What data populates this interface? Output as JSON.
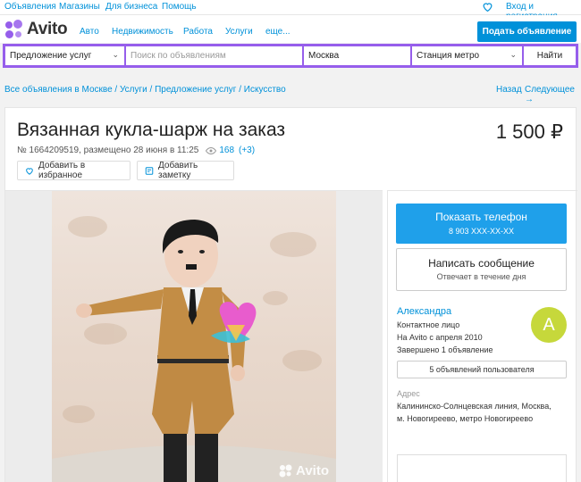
{
  "topbar": {
    "links": [
      "Объявления",
      "Магазины",
      "Для бизнеса",
      "Помощь"
    ],
    "login": "Вход и регистрация"
  },
  "header": {
    "logo": "Avito",
    "nav": [
      "Авто",
      "Недвижимость",
      "Работа",
      "Услуги",
      "еще..."
    ],
    "post_button": "Подать объявление"
  },
  "search": {
    "category": "Предложение услуг",
    "placeholder": "Поиск по объявлениям",
    "city": "Москва",
    "metro": "Станция метро",
    "find_button": "Найти"
  },
  "breadcrumb": "Все объявления в Москве / Услуги / Предложение услуг / Искусство",
  "pager": {
    "back": "Назад",
    "next": "Следующее →"
  },
  "listing": {
    "title": "Вязанная кукла-шарж на заказ",
    "price": "1 500 ₽",
    "meta": "№ 1664209519, размещено 28 июня в 11:25",
    "views": "168",
    "views_delta": "(+3)",
    "favorite_button": "Добавить в избранное",
    "note_button": "Добавить заметку",
    "photo_watermark": "Avito"
  },
  "contact": {
    "phone_button": "Показать телефон",
    "phone_masked": "8 903 XXX-XX-XX",
    "message_button": "Написать сообщение",
    "message_note": "Отвечает в течение дня"
  },
  "seller": {
    "name": "Александра",
    "lines": [
      "Контактное лицо",
      "На Avito с апреля 2010",
      "Завершено 1 объявление"
    ],
    "avatar_letter": "A",
    "ads_button": "5 объявлений пользователя"
  },
  "address": {
    "label": "Адрес",
    "lines": [
      "Калининско-Солнцевская линия, Москва,",
      "м. Новогиреево, метро Новогиреево"
    ]
  },
  "colors": {
    "accent": "#0091d9",
    "search_border": "#965eeb",
    "phone_button": "#1fa0ea",
    "avatar": "#c6d83b"
  },
  "icons": [
    "heart-icon",
    "logo-dots-icon",
    "chevron-down-icon",
    "eye-icon",
    "note-icon",
    "sticker-heart-icon"
  ]
}
